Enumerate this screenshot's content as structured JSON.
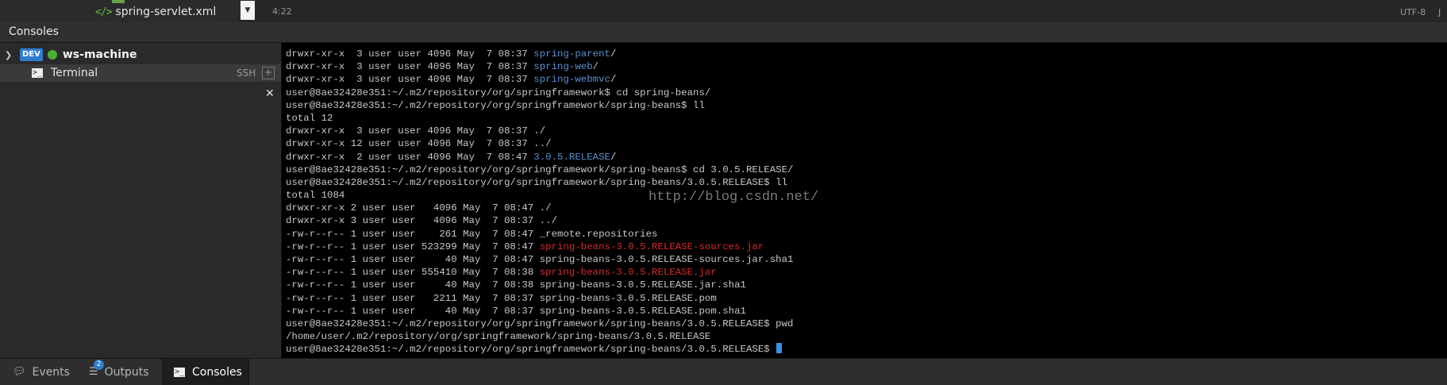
{
  "editor": {
    "file_name": "spring-servlet.xml",
    "cursor_position": "4:22",
    "encoding": "UTF-8",
    "language_initial": "J"
  },
  "panel": {
    "title": "Consoles"
  },
  "tree": {
    "machine": {
      "badge": "DEV",
      "name": "ws-machine",
      "status_color": "#4cae35"
    },
    "terminal": {
      "label": "Terminal",
      "ssh": "SSH",
      "add": "+"
    },
    "close": "✕"
  },
  "terminal": {
    "lines": [
      {
        "prefix": "drwxr-xr-x  3 user user 4096 May  7 08:37 ",
        "link": "spring-parent",
        "kind": "dir",
        "suffix": "/"
      },
      {
        "prefix": "drwxr-xr-x  3 user user 4096 May  7 08:37 ",
        "link": "spring-web",
        "kind": "dir",
        "suffix": "/"
      },
      {
        "prefix": "drwxr-xr-x  3 user user 4096 May  7 08:37 ",
        "link": "spring-webmvc",
        "kind": "dir",
        "suffix": "/"
      },
      {
        "prefix": "user@8ae32428e351:~/.m2/repository/org/springframework$ cd spring-beans/"
      },
      {
        "prefix": "user@8ae32428e351:~/.m2/repository/org/springframework/spring-beans$ ll"
      },
      {
        "prefix": "total 12"
      },
      {
        "prefix": "drwxr-xr-x  3 user user 4096 May  7 08:37 ./"
      },
      {
        "prefix": "drwxr-xr-x 12 user user 4096 May  7 08:37 ../"
      },
      {
        "prefix": "drwxr-xr-x  2 user user 4096 May  7 08:47 ",
        "link": "3.0.5.RELEASE",
        "kind": "dir",
        "suffix": "/"
      },
      {
        "prefix": "user@8ae32428e351:~/.m2/repository/org/springframework/spring-beans$ cd 3.0.5.RELEASE/"
      },
      {
        "prefix": "user@8ae32428e351:~/.m2/repository/org/springframework/spring-beans/3.0.5.RELEASE$ ll"
      },
      {
        "prefix": "total 1084"
      },
      {
        "prefix": "drwxr-xr-x 2 user user   4096 May  7 08:47 ./"
      },
      {
        "prefix": "drwxr-xr-x 3 user user   4096 May  7 08:37 ../"
      },
      {
        "prefix": "-rw-r--r-- 1 user user    261 May  7 08:47 _remote.repositories"
      },
      {
        "prefix": "-rw-r--r-- 1 user user 523299 May  7 08:47 ",
        "link": "spring-beans-3.0.5.RELEASE-sources.jar",
        "kind": "jar"
      },
      {
        "prefix": "-rw-r--r-- 1 user user     40 May  7 08:47 spring-beans-3.0.5.RELEASE-sources.jar.sha1"
      },
      {
        "prefix": "-rw-r--r-- 1 user user 555410 May  7 08:38 ",
        "link": "spring-beans-3.0.5.RELEASE.jar",
        "kind": "jar"
      },
      {
        "prefix": "-rw-r--r-- 1 user user     40 May  7 08:38 spring-beans-3.0.5.RELEASE.jar.sha1"
      },
      {
        "prefix": "-rw-r--r-- 1 user user   2211 May  7 08:37 spring-beans-3.0.5.RELEASE.pom"
      },
      {
        "prefix": "-rw-r--r-- 1 user user     40 May  7 08:37 spring-beans-3.0.5.RELEASE.pom.sha1"
      },
      {
        "prefix": "user@8ae32428e351:~/.m2/repository/org/springframework/spring-beans/3.0.5.RELEASE$ pwd"
      },
      {
        "prefix": "/home/user/.m2/repository/org/springframework/spring-beans/3.0.5.RELEASE"
      },
      {
        "prefix": "user@8ae32428e351:~/.m2/repository/org/springframework/spring-beans/3.0.5.RELEASE$ ",
        "cursor": true
      }
    ],
    "watermark": "http://blog.csdn.net/"
  },
  "bottom_tabs": {
    "events": "Events",
    "outputs": "Outputs",
    "outputs_badge": "2",
    "consoles": "Consoles"
  },
  "colors": {
    "dir": "#5b8fd0",
    "jar": "#d42b2b",
    "accent": "#2f7dd1",
    "status_running": "#4cae35"
  }
}
